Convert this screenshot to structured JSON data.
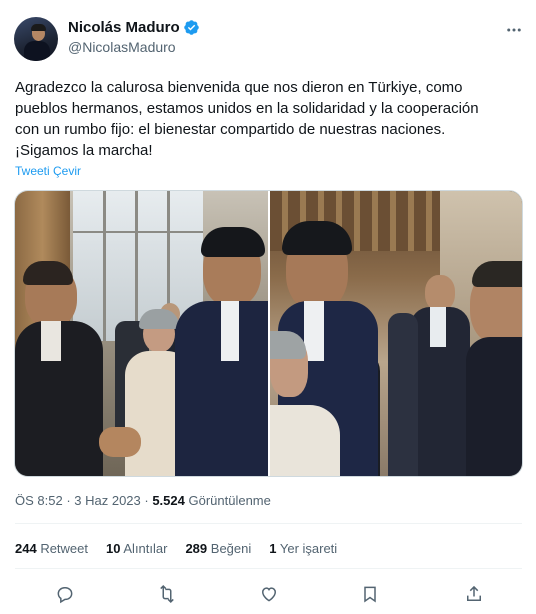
{
  "author": {
    "display_name": "Nicolás Maduro",
    "handle": "@NicolasMaduro",
    "verified_icon": "verified-badge-icon"
  },
  "tweet": {
    "lines": [
      "Agradezco la calurosa bienvenida que nos dieron en Türkiye, como",
      "pueblos hermanos, estamos unidos en la solidaridad y la cooperación",
      "con un rumbo fijo: el bienestar compartido de nuestras naciones.",
      "¡Sigamos la marcha!"
    ],
    "translate_label": "Tweeti Çevir"
  },
  "meta": {
    "time": "ÖS 8:52",
    "separator": " · ",
    "date": "3 Haz 2023",
    "views_count": "5.524",
    "views_label": " Görüntülenme"
  },
  "stats": [
    {
      "count": "244",
      "label": " Retweet"
    },
    {
      "count": "10",
      "label": " Alıntılar"
    },
    {
      "count": "289",
      "label": " Beğeni"
    },
    {
      "count": "1",
      "label": " Yer işareti"
    }
  ],
  "actions": [
    "reply-icon",
    "retweet-icon",
    "like-icon",
    "bookmark-icon",
    "share-icon"
  ],
  "colors": {
    "accent": "#1d9bf0",
    "text": "#0f1419",
    "secondary": "#536471"
  }
}
